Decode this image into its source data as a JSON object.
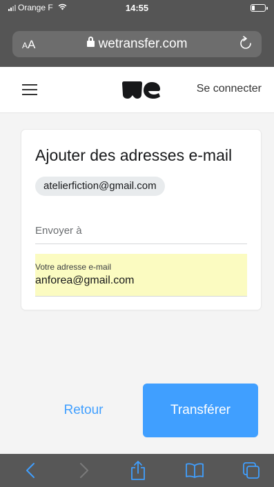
{
  "status_bar": {
    "carrier": "Orange F",
    "time": "14:55",
    "battery_level": 0.2
  },
  "browser": {
    "text_size_label": "AA",
    "url": "wetransfer.com"
  },
  "header": {
    "login_label": "Se connecter"
  },
  "form": {
    "title": "Ajouter des adresses e-mail",
    "recipient_chip": "atelierfiction@gmail.com",
    "send_to_placeholder": "Envoyer à",
    "sender_label": "Votre adresse e-mail",
    "sender_value": "anforea@gmail.com"
  },
  "actions": {
    "back_label": "Retour",
    "transfer_label": "Transférer"
  },
  "colors": {
    "accent": "#409fff",
    "autofill_bg": "#fbfbc1",
    "browser_chrome": "#555555"
  },
  "icons": {
    "back": "chevron-left-icon",
    "forward": "chevron-right-icon",
    "share": "share-icon",
    "bookmarks": "book-icon",
    "tabs": "tabs-icon",
    "reload": "reload-icon",
    "lock": "lock-icon",
    "menu": "hamburger-icon"
  }
}
